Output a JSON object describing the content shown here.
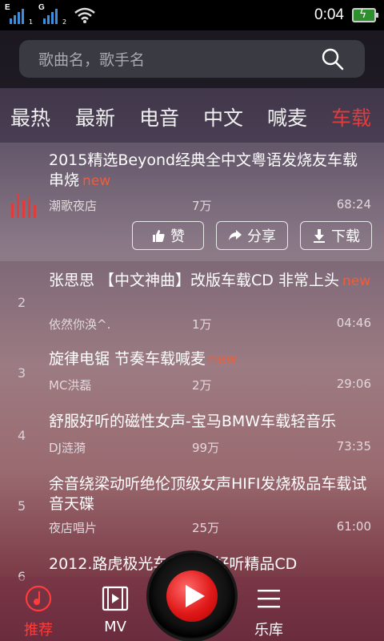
{
  "status_bar": {
    "signal1_net": "E",
    "signal1_slot": "1",
    "signal2_net": "G",
    "signal2_slot": "2",
    "time": "0:04"
  },
  "search": {
    "placeholder": "歌曲名，歌手名"
  },
  "tabs": [
    {
      "label": "最热"
    },
    {
      "label": "最新"
    },
    {
      "label": "电音"
    },
    {
      "label": "中文"
    },
    {
      "label": "喊麦"
    },
    {
      "label": "车载",
      "active": true
    }
  ],
  "list": [
    {
      "index": "",
      "title": "2015精选Beyond经典全中文粤语发烧友车载串烧",
      "new": "new",
      "artist": "潮歌夜店",
      "plays": "7万",
      "duration": "68:24"
    },
    {
      "index": "2",
      "title": "张思思 【中文神曲】改版车载CD 非常上头",
      "new": "new",
      "artist": "依然你涣^.",
      "plays": "1万",
      "duration": "04:46"
    },
    {
      "index": "3",
      "title": "旋律电锯 节奏车载喊麦",
      "new": "new",
      "artist": "MC洪磊",
      "plays": "2万",
      "duration": "29:06"
    },
    {
      "index": "4",
      "title": "舒服好听的磁性女声-宝马BMW车载轻音乐",
      "new": "",
      "artist": "DJ涟漪",
      "plays": "99万",
      "duration": "73:35"
    },
    {
      "index": "5",
      "title": "余音绕梁动听绝伦顶级女声HIFI发烧极品车载试音天碟",
      "new": "",
      "artist": "夜店唱片",
      "plays": "25万",
      "duration": "61:00"
    },
    {
      "index": "6",
      "title": "2012.路虎极光车载伤感好听精品CD",
      "new": "",
      "artist": "",
      "plays": "",
      "duration": ""
    }
  ],
  "actions": {
    "like": "赞",
    "share": "分享",
    "download": "下载"
  },
  "bottom_nav": {
    "recommend": "推荐",
    "mv": "MV",
    "library": "乐库"
  },
  "colors": {
    "accent": "#e23b3b",
    "new_tag": "#ef5d3a",
    "play_button": "#e01919"
  }
}
